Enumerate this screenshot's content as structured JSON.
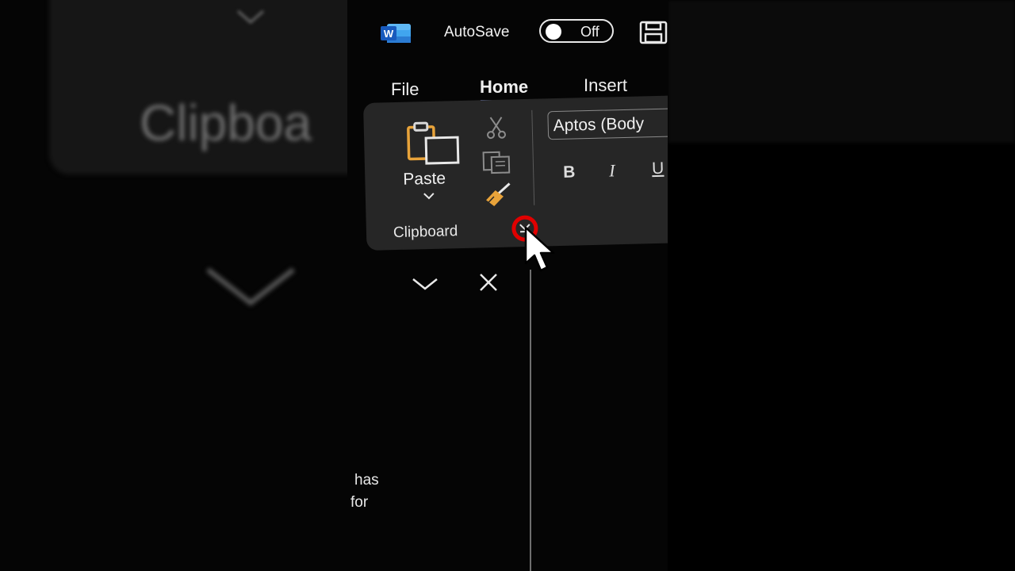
{
  "titlebar": {
    "app_icon": "word-icon",
    "autosave_label": "AutoSave",
    "autosave_state": "Off",
    "save_icon": "save-icon"
  },
  "tabs": [
    {
      "label": "File",
      "active": false
    },
    {
      "label": "Home",
      "active": true
    },
    {
      "label": "Insert",
      "active": false
    }
  ],
  "ribbon": {
    "clipboard": {
      "paste_label": "Paste",
      "group_label": "Clipboard",
      "icons": [
        "paste-icon",
        "cut-icon",
        "copy-icon",
        "format-painter-icon",
        "dialog-launcher-icon"
      ]
    },
    "font": {
      "font_name": "Aptos (Body",
      "bold": "B",
      "italic": "I",
      "underline": "U"
    }
  },
  "pane": {
    "icons": [
      "chevron-down-icon",
      "close-icon"
    ]
  },
  "document": {
    "line1": "has",
    "line2": "for"
  },
  "background": {
    "blurred_text": "Clipboa"
  },
  "colors": {
    "accent_underline": "#8a9ff0",
    "highlight_circle": "#e00000",
    "paste_orange": "#e8a33a",
    "ribbon_bg": "#262626"
  }
}
